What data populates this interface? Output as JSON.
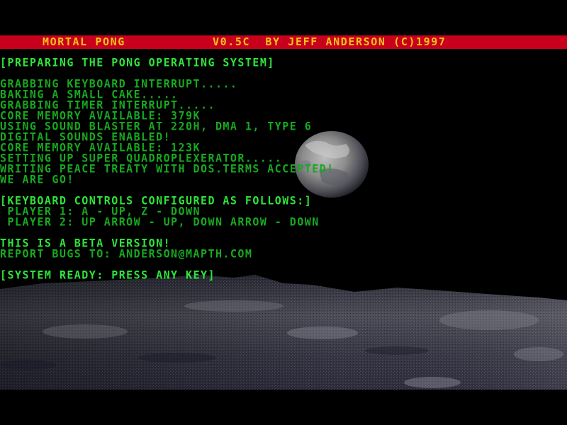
{
  "title_bar": {
    "game_name": "MORTAL PONG",
    "version_credit": "V0.5C  BY JEFF ANDERSON (C)1997",
    "bg_color": "#c8001c",
    "text_color": "#f2c21a"
  },
  "console": {
    "text_color": "#17a81f",
    "header": "[PREPARING THE PONG OPERATING SYSTEM]",
    "boot_lines": [
      "GRABBING KEYBOARD INTERRUPT.....",
      "BAKING A SMALL CAKE.....",
      "GRABBING TIMER INTERRUPT.....",
      "CORE MEMORY AVAILABLE: 379K",
      "USING SOUND BLASTER AT 220H, DMA 1, TYPE 6",
      "DIGITAL SOUNDS ENABLED!",
      "CORE MEMORY AVAILABLE: 123K",
      "SETTING UP SUPER QUADROPLEXERATOR.....",
      "WRITING PEACE TREATY WITH DOS.TERMS ACCEPTED!",
      "WE ARE GO!"
    ],
    "controls_header": "[KEYBOARD CONTROLS CONFIGURED AS FOLLOWS:]",
    "controls": [
      " PLAYER 1: A - UP, Z - DOWN",
      " PLAYER 2: UP ARROW - UP, DOWN ARROW - DOWN"
    ],
    "beta_notice": "THIS IS A BETA VERSION!",
    "report_bugs": "REPORT BUGS TO: ANDERSON@MAPTH.COM",
    "ready_prompt": "[SYSTEM READY: PRESS ANY KEY]"
  },
  "scenery": {
    "planet_icon": "planet-earth",
    "ground_icon": "moon-surface"
  }
}
